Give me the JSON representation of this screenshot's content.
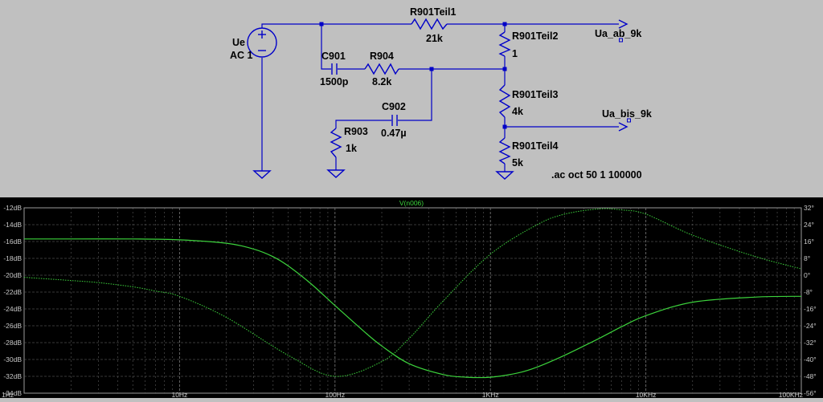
{
  "schematic": {
    "source": {
      "name": "Ue",
      "value": "AC 1"
    },
    "components": [
      {
        "name": "R901Teil1",
        "value": "21k"
      },
      {
        "name": "R901Teil2",
        "value": "1"
      },
      {
        "name": "C901",
        "value": "1500p"
      },
      {
        "name": "R904",
        "value": "8.2k"
      },
      {
        "name": "C902",
        "value": "0.47µ"
      },
      {
        "name": "R903",
        "value": "1k"
      },
      {
        "name": "R901Teil3",
        "value": "4k"
      },
      {
        "name": "R901Teil4",
        "value": "5k"
      }
    ],
    "labels": {
      "out_top": "Ua_ab_9k",
      "out_mid": "Ua_bis_9k"
    },
    "directive": ".ac oct 50 1 100000"
  },
  "plot": {
    "title": "V(n006)",
    "colors": {
      "background": "#000000",
      "trace": "#3cd23c",
      "grid": "#6e6e6e",
      "axis_text": "#c8c8c8"
    }
  },
  "chart_data": {
    "type": "line",
    "title": "V(n006)",
    "xscale": "log",
    "xlim": [
      1,
      100000
    ],
    "x_ticks": [
      "1Hz",
      "10Hz",
      "100Hz",
      "1KHz",
      "10KHz",
      "100KHz"
    ],
    "ylim_left": [
      -34,
      -12
    ],
    "y_ticks_left": [
      "-12dB",
      "-14dB",
      "-16dB",
      "-18dB",
      "-20dB",
      "-22dB",
      "-24dB",
      "-26dB",
      "-28dB",
      "-30dB",
      "-32dB",
      "-34dB"
    ],
    "ylim_right": [
      -56,
      32
    ],
    "y_ticks_right": [
      "32°",
      "24°",
      "16°",
      "8°",
      "0°",
      "-8°",
      "-16°",
      "-24°",
      "-32°",
      "-40°",
      "-48°",
      "-56°"
    ],
    "grid": true,
    "series": [
      {
        "axis": "left",
        "style": "solid",
        "x": [
          1,
          2,
          5,
          10,
          20,
          30,
          40,
          50,
          70,
          100,
          150,
          200,
          300,
          500,
          700,
          1000,
          1500,
          2000,
          3000,
          5000,
          7000,
          10000,
          20000,
          50000,
          100000
        ],
        "y": [
          -15.7,
          -15.7,
          -15.7,
          -15.8,
          -16.2,
          -16.9,
          -17.8,
          -18.9,
          -21,
          -23.6,
          -26.5,
          -28.4,
          -30.5,
          -31.8,
          -32.1,
          -32.1,
          -31.6,
          -30.9,
          -29.5,
          -27.5,
          -26.1,
          -24.8,
          -23.2,
          -22.6,
          -22.5
        ]
      },
      {
        "axis": "right",
        "style": "dotted",
        "x": [
          1,
          2,
          3,
          5,
          7,
          10,
          20,
          50,
          100,
          200,
          300,
          500,
          1000,
          2000,
          3000,
          5000,
          7000,
          10000,
          20000,
          50000,
          100000
        ],
        "y": [
          -1,
          -2.5,
          -3.5,
          -5.5,
          -7.5,
          -10,
          -20,
          -38,
          -48,
          -41,
          -30,
          -12,
          10,
          24,
          29,
          31.5,
          31,
          29,
          19,
          9,
          3
        ]
      }
    ]
  }
}
